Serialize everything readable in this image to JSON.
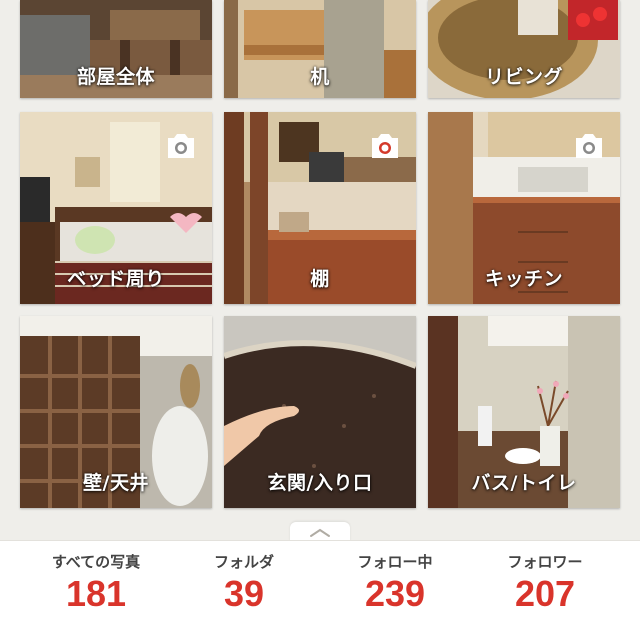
{
  "folders": [
    {
      "label": "部屋全体",
      "has_camera": false
    },
    {
      "label": "机",
      "has_camera": false
    },
    {
      "label": "リビング",
      "has_camera": false
    },
    {
      "label": "ベッド周り",
      "has_camera": true
    },
    {
      "label": "棚",
      "has_camera": true
    },
    {
      "label": "キッチン",
      "has_camera": true
    },
    {
      "label": "壁/天井",
      "has_camera": false
    },
    {
      "label": "玄関/入り口",
      "has_camera": false
    },
    {
      "label": "バス/トイレ",
      "has_camera": false
    }
  ],
  "stats": [
    {
      "label": "すべての写真",
      "value": "181"
    },
    {
      "label": "フォルダ",
      "value": "39"
    },
    {
      "label": "フォロー中",
      "value": "239"
    },
    {
      "label": "フォロワー",
      "value": "207"
    }
  ],
  "colors": {
    "accent": "#d9342b",
    "background": "#efeeea",
    "camera_icon": "#ffffff"
  },
  "icons": {
    "camera": "camera-icon",
    "collapse": "chevron-up-icon"
  }
}
